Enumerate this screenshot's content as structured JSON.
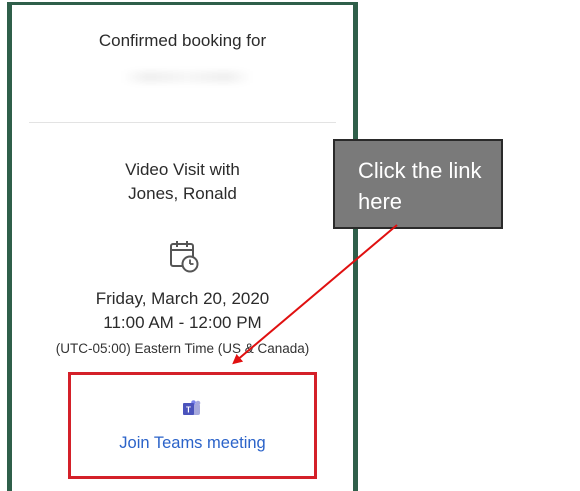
{
  "booking": {
    "confirmed_label": "Confirmed booking for",
    "visit_title_line1": "Video Visit with",
    "visit_title_line2": "Jones, Ronald",
    "date": "Friday, March 20, 2020",
    "time_range": "11:00 AM - 12:00 PM",
    "timezone": "(UTC-05:00) Eastern Time (US & Canada)",
    "join_link": "Join Teams meeting"
  },
  "annotation": {
    "callout_text": "Click the link here"
  },
  "icons": {
    "calendar": "calendar-clock-icon",
    "teams": "microsoft-teams-icon"
  },
  "colors": {
    "panel_border": "#2f5f4a",
    "highlight_box": "#d42029",
    "link": "#2b63c9",
    "callout_bg": "#7a7a7a",
    "arrow": "#e01010"
  }
}
